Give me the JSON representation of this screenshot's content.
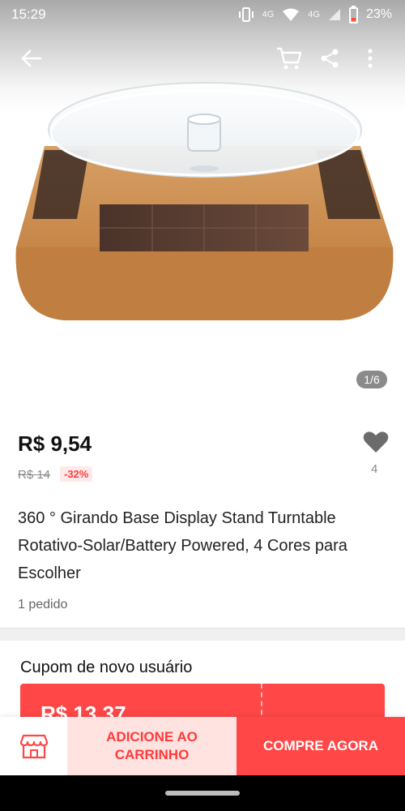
{
  "status_bar": {
    "time": "15:29",
    "network_1": "4G",
    "network_2": "4G",
    "battery": "23%"
  },
  "icons": {
    "back": "arrow-left-icon",
    "cart": "cart-icon",
    "share": "share-icon",
    "more": "more-vertical-icon",
    "wishlist": "heart-icon",
    "store": "store-icon"
  },
  "gallery": {
    "counter": "1/6"
  },
  "product": {
    "price": "R$ 9,54",
    "original_price": "R$ 14",
    "discount": "-32%",
    "wishlist_count": "4",
    "title": "360 ° Girando Base Display Stand Turntable Rotativo-Solar/Battery Powered, 4 Cores para Escolher",
    "orders": "1 pedido"
  },
  "coupon": {
    "title": "Cupom de novo usuário",
    "value": "R$ 13,37"
  },
  "actions": {
    "add_to_cart": "ADICIONE AO CARRINHO",
    "buy_now": "COMPRE AGORA"
  },
  "colors": {
    "accent": "#ff4747",
    "cart_bg": "#ffe3e1",
    "discount_bg": "#ffe9e9"
  }
}
